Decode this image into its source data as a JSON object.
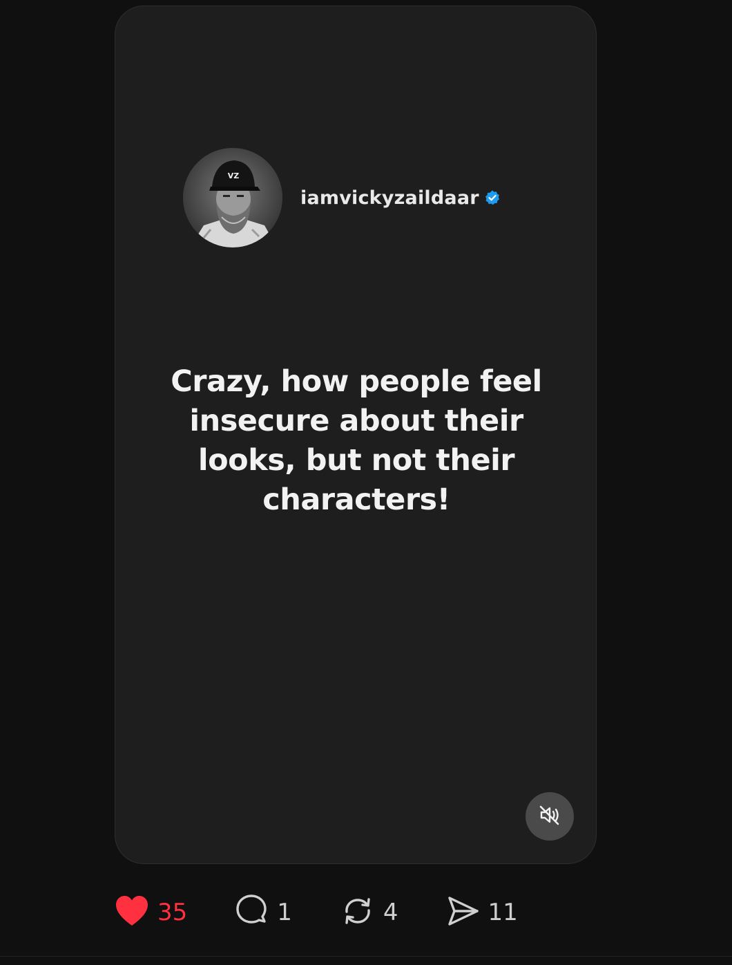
{
  "post": {
    "author": {
      "username": "iamvickyzaildaar",
      "verified": true,
      "cap_text": "VZ"
    },
    "quote": "Crazy, how people feel insecure about their looks, but not their characters!",
    "media": {
      "muted": true
    }
  },
  "actions": {
    "likes": "35",
    "replies": "1",
    "reposts": "4",
    "shares": "11"
  },
  "colors": {
    "background": "#101010",
    "card": "#1e1e1e",
    "like": "#ff3040",
    "verified": "#1d9bf0",
    "text": "#f2f2f2"
  },
  "icons": {
    "like": "heart-filled-icon",
    "reply": "speech-bubble-icon",
    "repost": "repost-icon",
    "share": "send-icon",
    "mute": "speaker-muted-icon",
    "verified": "verified-badge-icon"
  }
}
